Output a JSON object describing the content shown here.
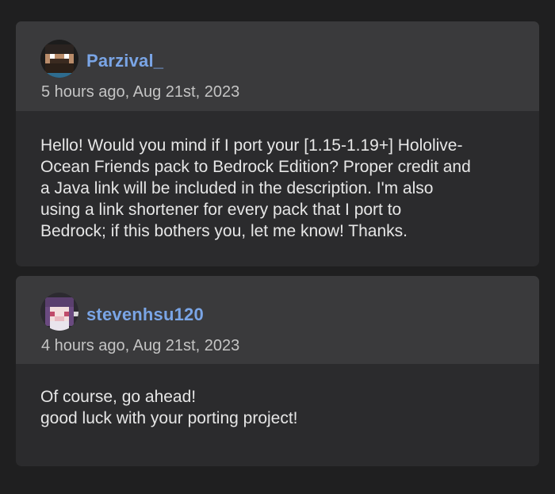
{
  "comments": [
    {
      "username": "Parzival_",
      "avatar_icon": "player-skin-avatar-bearded",
      "timestamp": "5 hours ago, Aug 21st, 2023",
      "body_lines": [
        "Hello! Would you mind if I port your [1.15-1.19+] Hololive-",
        "Ocean Friends pack to Bedrock Edition? Proper credit and",
        "a Java link will be included in the description. I'm also",
        "using a link shortener for every pack that I port to",
        "Bedrock; if this bothers you, let me know! Thanks."
      ]
    },
    {
      "username": "stevenhsu120",
      "avatar_icon": "player-skin-avatar-purple-hair",
      "timestamp": "4 hours ago, Aug 21st, 2023",
      "body_lines": [
        "Of course, go ahead!",
        "good luck with your porting project!"
      ]
    }
  ],
  "colors": {
    "page_background": "#1f1f20",
    "card_header": "#3a3a3c",
    "card_body": "#2b2b2d",
    "username": "#7aa5e6",
    "timestamp": "#c4c4c4",
    "body_text": "#e6e6e6"
  }
}
